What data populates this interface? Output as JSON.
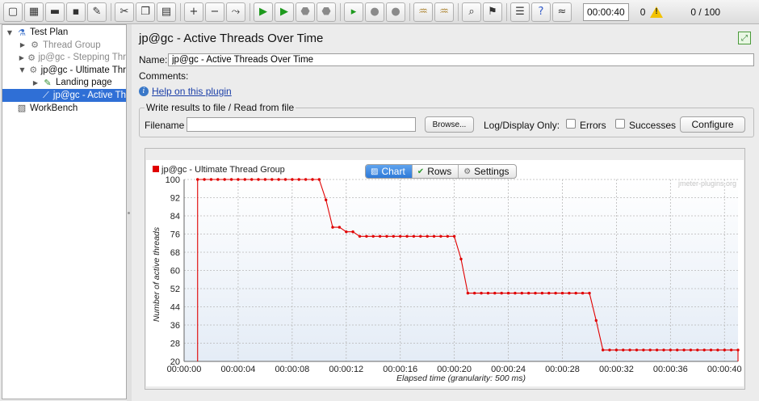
{
  "toolbar": {
    "buttons": [
      {
        "name": "new-icon",
        "glyph": "▢"
      },
      {
        "name": "templates-icon",
        "glyph": "▦"
      },
      {
        "name": "open-icon",
        "glyph": "▬"
      },
      {
        "name": "save-icon",
        "glyph": "▪"
      },
      {
        "name": "save-as-icon",
        "glyph": "✎"
      },
      {
        "sep": true
      },
      {
        "name": "cut-icon",
        "glyph": "✂"
      },
      {
        "name": "copy-icon",
        "glyph": "❐"
      },
      {
        "name": "paste-icon",
        "glyph": "▤"
      },
      {
        "sep": true
      },
      {
        "name": "expand-all-icon",
        "glyph": "+"
      },
      {
        "name": "collapse-all-icon",
        "glyph": "−"
      },
      {
        "name": "toggle-icon",
        "glyph": "⤳"
      },
      {
        "sep": true
      },
      {
        "name": "start-icon",
        "glyph": "▶"
      },
      {
        "name": "start-no-pauses-icon",
        "glyph": "▶"
      },
      {
        "name": "stop-icon",
        "glyph": "⬣"
      },
      {
        "name": "shutdown-icon",
        "glyph": "⬣"
      },
      {
        "sep": true
      },
      {
        "name": "remote-start-icon",
        "glyph": "▸"
      },
      {
        "name": "remote-stop-icon",
        "glyph": "●"
      },
      {
        "name": "remote-shutdown-icon",
        "glyph": "●"
      },
      {
        "sep": true
      },
      {
        "name": "clear-icon",
        "glyph": "♒"
      },
      {
        "name": "clear-all-icon",
        "glyph": "♒"
      },
      {
        "sep": true
      },
      {
        "name": "search-icon",
        "glyph": "⌕"
      },
      {
        "name": "reset-search-icon",
        "glyph": "⚑"
      },
      {
        "sep": true
      },
      {
        "name": "function-helper-icon",
        "glyph": "☰"
      },
      {
        "name": "help-icon",
        "glyph": "?"
      },
      {
        "name": "log-viewer-icon",
        "glyph": "≈"
      }
    ],
    "timer": "00:00:40",
    "error_count": "0",
    "threads": "0 / 100",
    "colors": {
      "start": "#1e9a1e",
      "stop": "#8a8a8a",
      "help": "#2f57c6",
      "clear": "#b08a3c"
    }
  },
  "tree": [
    {
      "label": "Test Plan",
      "level": 0,
      "toggle": "▼",
      "icon": "flask-icon",
      "glyph": "⚗",
      "state": "normal"
    },
    {
      "label": "Thread Group",
      "level": 1,
      "toggle": "▶",
      "icon": "gear-icon",
      "glyph": "⚙",
      "state": "dim"
    },
    {
      "label": "jp@gc - Stepping Thr",
      "level": 1,
      "toggle": "▶",
      "icon": "gear-icon",
      "glyph": "⚙",
      "state": "dim"
    },
    {
      "label": "jp@gc - Ultimate Thr",
      "level": 1,
      "toggle": "▼",
      "icon": "gear-icon",
      "glyph": "⚙",
      "state": "normal"
    },
    {
      "label": "Landing page",
      "level": 2,
      "toggle": "▶",
      "icon": "pen-icon",
      "glyph": "✎",
      "state": "normal"
    },
    {
      "label": "jp@gc - Active Th",
      "level": 2,
      "toggle": "",
      "icon": "graph-icon",
      "glyph": "⟋",
      "state": "sel"
    },
    {
      "label": "WorkBench",
      "level": 0,
      "toggle": "",
      "icon": "workbench-icon",
      "glyph": "▧",
      "state": "normal"
    }
  ],
  "panel": {
    "title": "jp@gc - Active Threads Over Time",
    "name_label": "Name:",
    "name_value": "jp@gc - Active Threads Over Time",
    "comments_label": "Comments:",
    "help_link": "Help on this plugin",
    "file_legend": "Write results to file / Read from file",
    "filename_label": "Filename",
    "browse_label": "Browse...",
    "logdisplay_label": "Log/Display Only:",
    "errors_label": "Errors",
    "successes_label": "Successes",
    "configure_label": "Configure"
  },
  "tabs": [
    {
      "label": "Chart",
      "icon": "chart-icon",
      "glyph": "▨",
      "active": true
    },
    {
      "label": "Rows",
      "icon": "check-icon",
      "glyph": "✔",
      "active": false
    },
    {
      "label": "Settings",
      "icon": "gear-icon",
      "glyph": "⚙",
      "active": false
    }
  ],
  "chart_data": {
    "type": "line",
    "title": "",
    "watermark": "jmeter-plugins.org",
    "xlabel": "Elapsed time (granularity: 500 ms)",
    "ylabel": "Number of active threads",
    "xlim": [
      0,
      41
    ],
    "ylim": [
      20,
      100
    ],
    "x_ticks": [
      "00:00:00",
      "00:00:04",
      "00:00:08",
      "00:00:12",
      "00:00:16",
      "00:00:20",
      "00:00:24",
      "00:00:28",
      "00:00:32",
      "00:00:36",
      "00:00:40"
    ],
    "y_ticks": [
      20,
      28,
      36,
      44,
      52,
      60,
      68,
      76,
      84,
      92,
      100
    ],
    "series": [
      {
        "name": "jp@gc - Ultimate Thread Group",
        "color": "#e00000",
        "points": [
          [
            1.0,
            100
          ],
          [
            1.5,
            100
          ],
          [
            2.0,
            100
          ],
          [
            2.5,
            100
          ],
          [
            3.0,
            100
          ],
          [
            3.5,
            100
          ],
          [
            4.0,
            100
          ],
          [
            4.5,
            100
          ],
          [
            5.0,
            100
          ],
          [
            5.5,
            100
          ],
          [
            6.0,
            100
          ],
          [
            6.5,
            100
          ],
          [
            7.0,
            100
          ],
          [
            7.5,
            100
          ],
          [
            8.0,
            100
          ],
          [
            8.5,
            100
          ],
          [
            9.0,
            100
          ],
          [
            9.5,
            100
          ],
          [
            10.0,
            100
          ],
          [
            10.5,
            91
          ],
          [
            11.0,
            79
          ],
          [
            11.5,
            79
          ],
          [
            12.0,
            77
          ],
          [
            12.5,
            77
          ],
          [
            13.0,
            75
          ],
          [
            13.5,
            75
          ],
          [
            14.0,
            75
          ],
          [
            14.5,
            75
          ],
          [
            15.0,
            75
          ],
          [
            15.5,
            75
          ],
          [
            16.0,
            75
          ],
          [
            16.5,
            75
          ],
          [
            17.0,
            75
          ],
          [
            17.5,
            75
          ],
          [
            18.0,
            75
          ],
          [
            18.5,
            75
          ],
          [
            19.0,
            75
          ],
          [
            19.5,
            75
          ],
          [
            20.0,
            75
          ],
          [
            20.5,
            65
          ],
          [
            21.0,
            50
          ],
          [
            21.5,
            50
          ],
          [
            22.0,
            50
          ],
          [
            22.5,
            50
          ],
          [
            23.0,
            50
          ],
          [
            23.5,
            50
          ],
          [
            24.0,
            50
          ],
          [
            24.5,
            50
          ],
          [
            25.0,
            50
          ],
          [
            25.5,
            50
          ],
          [
            26.0,
            50
          ],
          [
            26.5,
            50
          ],
          [
            27.0,
            50
          ],
          [
            27.5,
            50
          ],
          [
            28.0,
            50
          ],
          [
            28.5,
            50
          ],
          [
            29.0,
            50
          ],
          [
            29.5,
            50
          ],
          [
            30.0,
            50
          ],
          [
            30.5,
            38
          ],
          [
            31.0,
            25
          ],
          [
            31.5,
            25
          ],
          [
            32.0,
            25
          ],
          [
            32.5,
            25
          ],
          [
            33.0,
            25
          ],
          [
            33.5,
            25
          ],
          [
            34.0,
            25
          ],
          [
            34.5,
            25
          ],
          [
            35.0,
            25
          ],
          [
            35.5,
            25
          ],
          [
            36.0,
            25
          ],
          [
            36.5,
            25
          ],
          [
            37.0,
            25
          ],
          [
            37.5,
            25
          ],
          [
            38.0,
            25
          ],
          [
            38.5,
            25
          ],
          [
            39.0,
            25
          ],
          [
            39.5,
            25
          ],
          [
            40.0,
            25
          ],
          [
            40.5,
            25
          ],
          [
            41.0,
            25
          ]
        ]
      }
    ],
    "drops": [
      1.0,
      41.0
    ],
    "grid": true,
    "legend_position": "top-left"
  }
}
